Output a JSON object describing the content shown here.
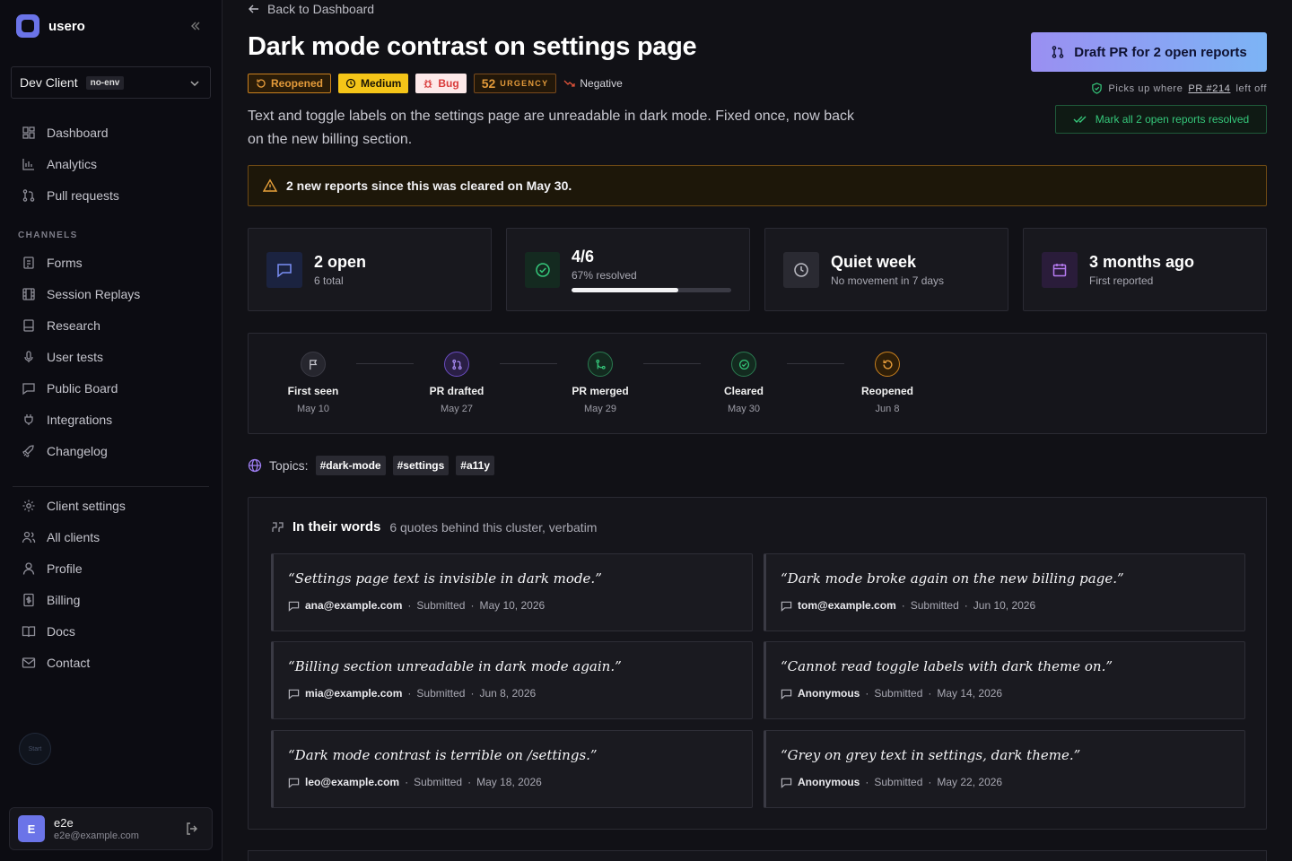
{
  "brand": {
    "name": "usero"
  },
  "client": {
    "name": "Dev Client",
    "env": "no-env"
  },
  "sidebar": {
    "primary": [
      {
        "label": "Dashboard",
        "icon": "dashboard-icon"
      },
      {
        "label": "Analytics",
        "icon": "analytics-icon"
      },
      {
        "label": "Pull requests",
        "icon": "pull-request-icon"
      }
    ],
    "channels_label": "CHANNELS",
    "channels": [
      {
        "label": "Forms",
        "icon": "forms-icon"
      },
      {
        "label": "Session Replays",
        "icon": "film-icon"
      },
      {
        "label": "Research",
        "icon": "research-icon"
      },
      {
        "label": "User tests",
        "icon": "mic-icon"
      },
      {
        "label": "Public Board",
        "icon": "chat-icon"
      },
      {
        "label": "Integrations",
        "icon": "plug-icon"
      },
      {
        "label": "Changelog",
        "icon": "rocket-icon"
      }
    ],
    "settings": [
      {
        "label": "Client settings",
        "icon": "gear-icon"
      },
      {
        "label": "All clients",
        "icon": "users-icon"
      },
      {
        "label": "Profile",
        "icon": "user-icon"
      },
      {
        "label": "Billing",
        "icon": "billing-icon"
      },
      {
        "label": "Docs",
        "icon": "book-icon"
      },
      {
        "label": "Contact",
        "icon": "mail-icon"
      }
    ],
    "start_label": "Start"
  },
  "user": {
    "initial": "E",
    "name": "e2e",
    "email": "e2e@example.com"
  },
  "header": {
    "back_label": "Back to Dashboard",
    "title": "Dark mode contrast on settings page",
    "badges": {
      "status": "Reopened",
      "priority": "Medium",
      "type": "Bug",
      "urgency_value": "52",
      "urgency_label": "URGENCY",
      "sentiment": "Negative"
    },
    "description": "Text and toggle labels on the settings page are unreadable in dark mode. Fixed once, now back on the new billing section.",
    "draft_button": "Draft PR for 2 open reports",
    "picks_prefix": "Picks up where",
    "picks_link": "PR #214",
    "picks_suffix": "left off",
    "resolve_button": "Mark all 2 open reports resolved"
  },
  "alert": {
    "text": "2 new reports since this was cleared on May 30."
  },
  "stats": [
    {
      "value": "2 open",
      "sub": "6 total"
    },
    {
      "value": "4/6",
      "sub": "67% resolved",
      "progress": 0.67
    },
    {
      "value": "Quiet week",
      "sub": "No movement in 7 days"
    },
    {
      "value": "3 months ago",
      "sub": "First reported"
    }
  ],
  "timeline": [
    {
      "label": "First seen",
      "date": "May 10"
    },
    {
      "label": "PR drafted",
      "date": "May 27"
    },
    {
      "label": "PR merged",
      "date": "May 29"
    },
    {
      "label": "Cleared",
      "date": "May 30"
    },
    {
      "label": "Reopened",
      "date": "Jun 8"
    }
  ],
  "topics": {
    "label": "Topics:",
    "tags": [
      "#dark-mode",
      "#settings",
      "#a11y"
    ]
  },
  "quotes": {
    "title": "In their words",
    "subtitle": "6 quotes behind this cluster, verbatim",
    "submitted_label": "Submitted",
    "items": [
      {
        "text": "“Settings page text is invisible in dark mode.”",
        "author": "ana@example.com",
        "date": "May 10, 2026"
      },
      {
        "text": "“Dark mode broke again on the new billing page.”",
        "author": "tom@example.com",
        "date": "Jun 10, 2026"
      },
      {
        "text": "“Billing section unreadable in dark mode again.”",
        "author": "mia@example.com",
        "date": "Jun 8, 2026"
      },
      {
        "text": "“Cannot read toggle labels with dark theme on.”",
        "author": "Anonymous",
        "date": "May 14, 2026"
      },
      {
        "text": "“Dark mode contrast is terrible on /settings.”",
        "author": "leo@example.com",
        "date": "May 18, 2026"
      },
      {
        "text": "“Grey on grey text in settings, dark theme.”",
        "author": "Anonymous",
        "date": "May 22, 2026"
      }
    ]
  },
  "colors": {
    "accent": "#6b74e8",
    "warning": "#e39a3a",
    "success": "#35c77a",
    "bug": "#d93a3a",
    "medium": "#f5c518"
  }
}
